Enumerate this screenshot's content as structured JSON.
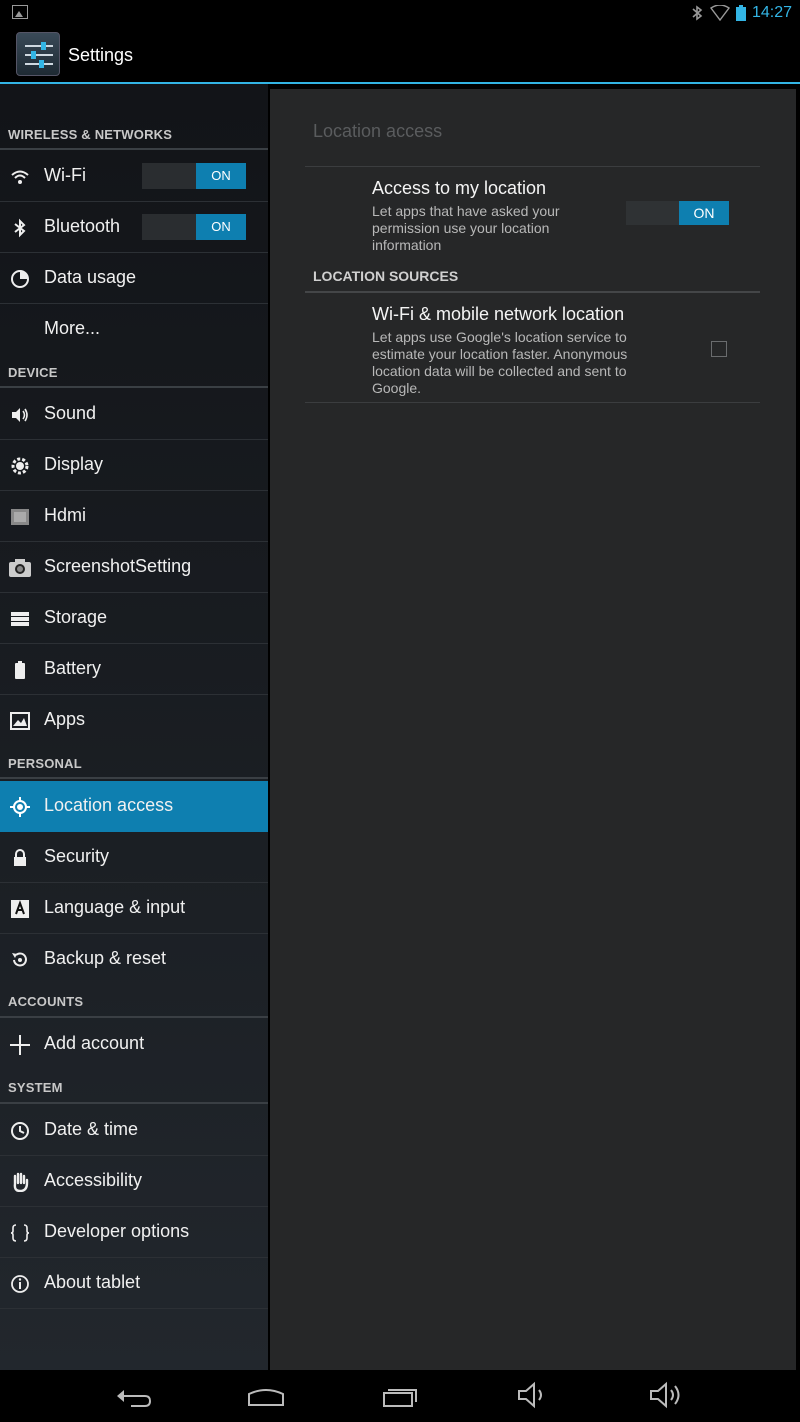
{
  "status_bar": {
    "time": "14:27"
  },
  "action_bar": {
    "title": "Settings"
  },
  "sidebar": {
    "sections": [
      {
        "label": "WIRELESS & NETWORKS"
      },
      {
        "label": "DEVICE"
      },
      {
        "label": "PERSONAL"
      },
      {
        "label": "ACCOUNTS"
      },
      {
        "label": "SYSTEM"
      }
    ],
    "items": [
      {
        "label": "Wi-Fi",
        "icon": "wifi-icon",
        "toggle": "ON"
      },
      {
        "label": "Bluetooth",
        "icon": "bluetooth-icon",
        "toggle": "ON"
      },
      {
        "label": "Data usage",
        "icon": "data-usage-icon"
      },
      {
        "label": "More..."
      },
      {
        "label": "Sound",
        "icon": "speaker-icon"
      },
      {
        "label": "Display",
        "icon": "brightness-icon"
      },
      {
        "label": "Hdmi",
        "icon": "monitor-icon"
      },
      {
        "label": "ScreenshotSetting",
        "icon": "camera-icon"
      },
      {
        "label": "Storage",
        "icon": "storage-icon"
      },
      {
        "label": "Battery",
        "icon": "battery-icon"
      },
      {
        "label": "Apps",
        "icon": "apps-icon"
      },
      {
        "label": "Location access",
        "icon": "location-icon",
        "selected": true
      },
      {
        "label": "Security",
        "icon": "lock-icon"
      },
      {
        "label": "Language & input",
        "icon": "language-icon"
      },
      {
        "label": "Backup & reset",
        "icon": "backup-icon"
      },
      {
        "label": "Add account",
        "icon": "plus-icon"
      },
      {
        "label": "Date & time",
        "icon": "clock-icon"
      },
      {
        "label": "Accessibility",
        "icon": "hand-icon"
      },
      {
        "label": "Developer options",
        "icon": "braces-icon"
      },
      {
        "label": "About tablet",
        "icon": "info-icon"
      }
    ]
  },
  "detail": {
    "title": "Location access",
    "access": {
      "title": "Access to my location",
      "summary": "Let apps that have asked your permission use your location information",
      "summary_lines": [
        "Let apps that have asked your",
        "permission use your location",
        "information"
      ],
      "toggle": "ON"
    },
    "sources_header": "LOCATION SOURCES",
    "wifi_location": {
      "title": "Wi-Fi & mobile network location",
      "summary_lines": [
        "Let apps use Google's location service to",
        "estimate your location faster. Anonymous",
        "location data will be collected and sent to",
        "Google."
      ],
      "checked": false
    }
  },
  "colors": {
    "accent": "#33b5e5",
    "selected": "#0e7fb0",
    "panel": "#262728"
  }
}
